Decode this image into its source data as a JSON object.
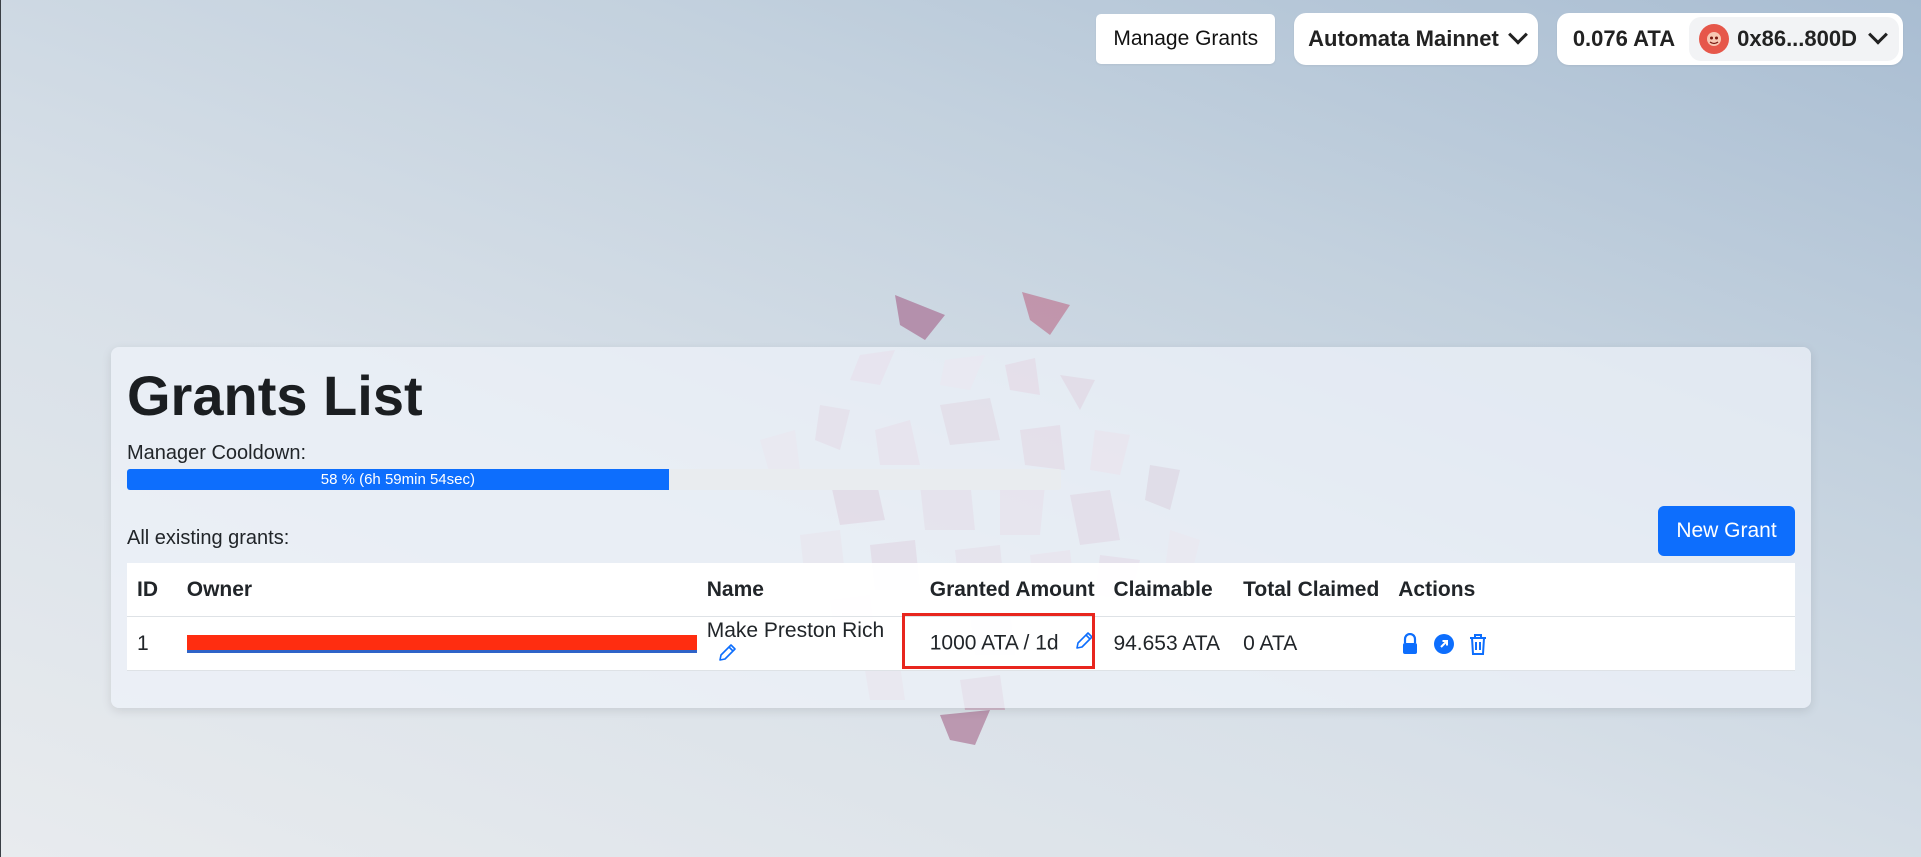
{
  "header": {
    "manage_grants_label": "Manage Grants",
    "network_label": "Automata Mainnet",
    "balance": "0.076 ATA",
    "account_address": "0x86...800D"
  },
  "grants_page": {
    "title": "Grants List",
    "cooldown_label": "Manager Cooldown:",
    "cooldown_progress_text": "58 % (6h 59min 54sec)",
    "cooldown_percent": 58,
    "all_grants_label": "All existing grants:",
    "new_grant_label": "New Grant",
    "columns": [
      "ID",
      "Owner",
      "Name",
      "Granted Amount",
      "Claimable",
      "Total Claimed",
      "Actions"
    ],
    "rows": [
      {
        "id": "1",
        "name": "Make Preston Rich",
        "granted_amount": "1000 ATA / 1d",
        "claimable": "94.653 ATA",
        "total_claimed": "0 ATA"
      }
    ]
  },
  "colors": {
    "primary": "#0d6efd",
    "highlight_border": "#e8261e",
    "redaction": "#ff2d10"
  },
  "icons": [
    "pencil-icon",
    "lock-icon",
    "arrow-up-right-circle-icon",
    "trash-icon",
    "chevron-down-icon"
  ]
}
